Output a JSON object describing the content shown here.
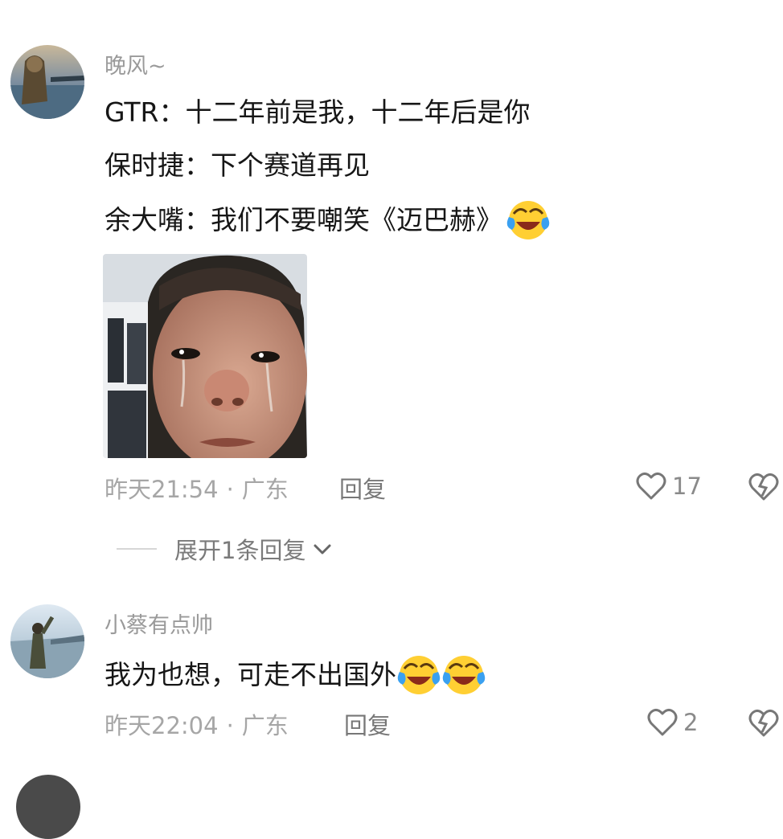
{
  "comments": [
    {
      "username": "晚风~",
      "lines": [
        "GTR：十二年前是我，十二年后是你",
        "保时捷：下个赛道再见",
        "余大嘴：我们不要嘲笑《迈巴赫》"
      ],
      "line3_emoji": "laughing-tears-emoji",
      "has_image": true,
      "image_icon": "crying-man-photo",
      "time": "昨天21:54",
      "separator": "·",
      "location": "广东",
      "reply_label": "回复",
      "likes": "17",
      "expand_label": "展开1条回复"
    },
    {
      "username": "小蔡有点帅",
      "text": "我为也想，可走不出国外",
      "emojis": [
        "laughing-tears-emoji",
        "laughing-tears-emoji"
      ],
      "time": "昨天22:04",
      "separator": "·",
      "location": "广东",
      "reply_label": "回复",
      "likes": "2"
    }
  ],
  "colors": {
    "username": "#9a9a9a",
    "text": "#161616",
    "meta": "#a6a6a6",
    "background": "#ffffff"
  }
}
